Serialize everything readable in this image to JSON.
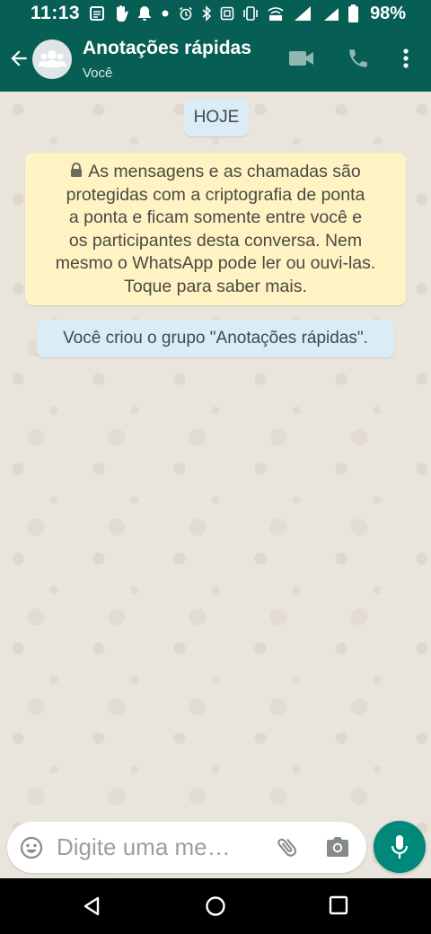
{
  "status_bar": {
    "time": "11:13",
    "battery": "98%",
    "icons": [
      "notes-icon",
      "hand-icon",
      "notification-icon",
      "dot-icon",
      "alarm-icon",
      "bluetooth-icon",
      "nfc-icon",
      "vibrate-icon",
      "lte-wifi-icon",
      "signal-icon",
      "signal-2-icon",
      "battery-icon"
    ]
  },
  "header": {
    "title": "Anotações rápidas",
    "subtitle": "Você",
    "avatar_icon": "group-avatar-icon",
    "actions": [
      "video-call-icon",
      "voice-call-icon",
      "more-options-icon"
    ]
  },
  "chat": {
    "date_chip": "HOJE",
    "encryption_notice": {
      "lines": [
        "As mensagens e as chamadas são",
        "protegidas com a criptografia de ponta",
        "a ponta e ficam somente entre você e",
        "os participantes desta conversa. Nem",
        "mesmo o WhatsApp pode ler ou ouvi-las.",
        "Toque para saber mais."
      ]
    },
    "system_message": "Você criou o grupo \"Anotações rápidas\"."
  },
  "composer": {
    "placeholder": "Digite uma me…",
    "icons": [
      "emoji-icon",
      "attach-icon",
      "camera-icon",
      "microphone-icon"
    ]
  },
  "colors": {
    "header": "#075e54",
    "accent_button": "#00897b",
    "notice_bg": "#fff3c4",
    "chip_bg": "#dcecf4"
  },
  "nav_bar": {
    "buttons": [
      "back-triangle-icon",
      "home-circle-icon",
      "recents-square-icon"
    ]
  }
}
